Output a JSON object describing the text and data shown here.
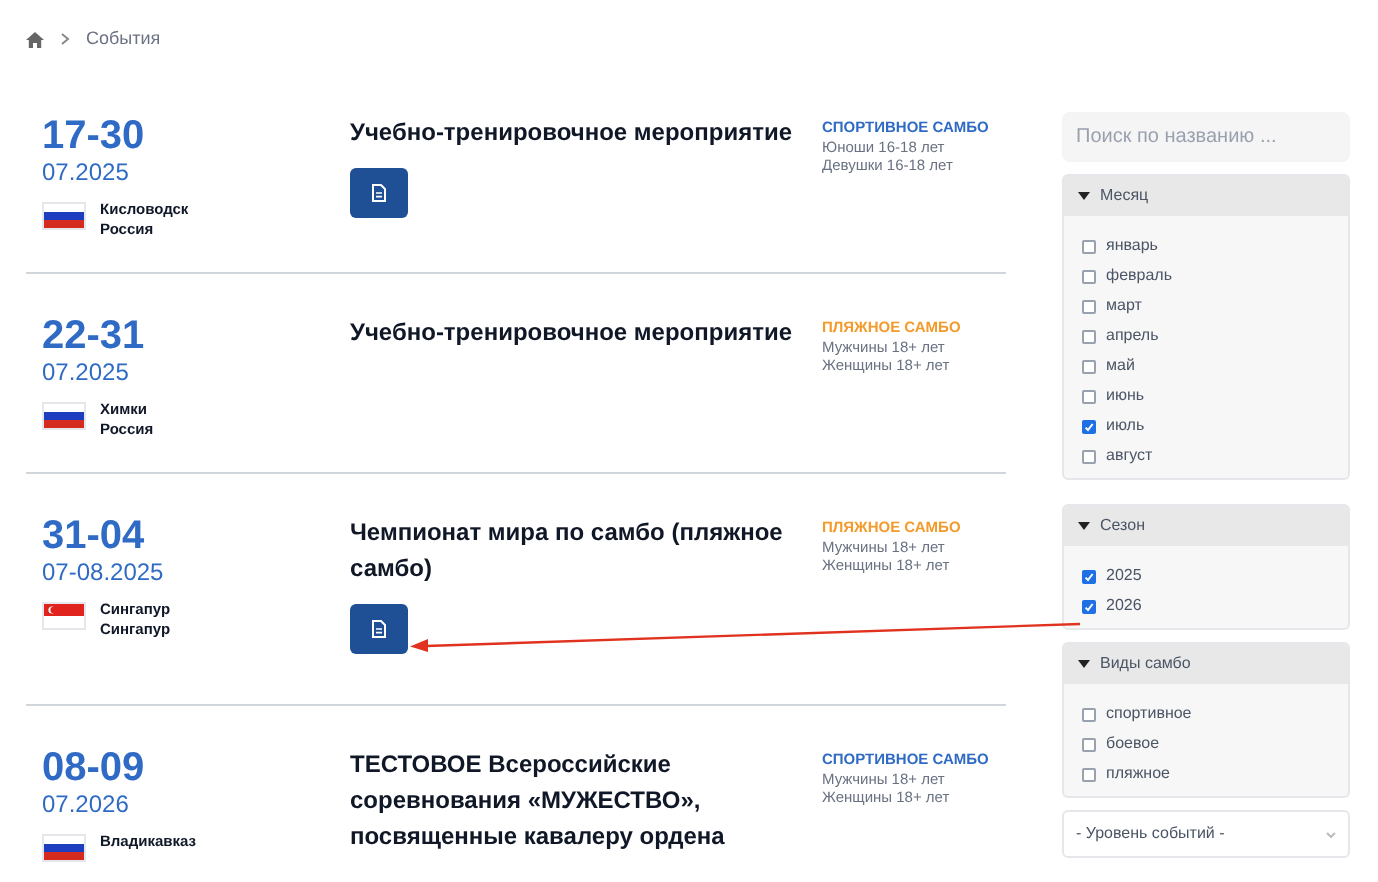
{
  "breadcrumb": {
    "current": "События"
  },
  "events": [
    {
      "days": "17-30",
      "period": "07.2025",
      "flag": {
        "kind": "russia"
      },
      "city": "Кисловодск",
      "country": "Россия",
      "title": "Учебно-тренировочное мероприятие",
      "has_document": true,
      "category": {
        "text": "СПОРТИВНОЕ САМБО",
        "kind": "sport"
      },
      "groups": [
        "Юноши 16-18 лет",
        "Девушки 16-18 лет"
      ]
    },
    {
      "days": "22-31",
      "period": "07.2025",
      "flag": {
        "kind": "russia"
      },
      "city": "Химки",
      "country": "Россия",
      "title": "Учебно-тренировочное мероприятие",
      "has_document": false,
      "category": {
        "text": "ПЛЯЖНОЕ САМБО",
        "kind": "beach"
      },
      "groups": [
        "Мужчины 18+ лет",
        "Женщины 18+ лет"
      ]
    },
    {
      "days": "31-04",
      "period": "07-08.2025",
      "flag": {
        "kind": "singapore"
      },
      "city": "Сингапур",
      "country": "Сингапур",
      "title": "Чемпионат мира по самбо (пляжное самбо)",
      "has_document": true,
      "category": {
        "text": "ПЛЯЖНОЕ САМБО",
        "kind": "beach"
      },
      "groups": [
        "Мужчины 18+ лет",
        "Женщины 18+ лет"
      ]
    },
    {
      "days": "08-09",
      "period": "07.2026",
      "flag": {
        "kind": "russia"
      },
      "city": "Владикавказ",
      "title": "ТЕСТОВОЕ Всероссийские соревнования «МУЖЕСТВО», посвященные кавалеру ордена",
      "has_document": false,
      "category": {
        "text": "СПОРТИВНОЕ САМБО",
        "kind": "sport"
      },
      "groups": [
        "Мужчины 18+ лет",
        "Женщины 18+ лет"
      ]
    }
  ],
  "search": {
    "placeholder": "Поиск по названию ..."
  },
  "filters": [
    {
      "title": "Месяц",
      "options": [
        {
          "label": "январь",
          "checked": false
        },
        {
          "label": "февраль",
          "checked": false
        },
        {
          "label": "март",
          "checked": false
        },
        {
          "label": "апрель",
          "checked": false
        },
        {
          "label": "май",
          "checked": false
        },
        {
          "label": "июнь",
          "checked": false
        },
        {
          "label": "июль",
          "checked": true
        },
        {
          "label": "август",
          "checked": false
        }
      ]
    },
    {
      "title": "Сезон",
      "options": [
        {
          "label": "2025",
          "checked": true
        },
        {
          "label": "2026",
          "checked": true
        }
      ]
    },
    {
      "title": "Виды самбо",
      "options": [
        {
          "label": "спортивное",
          "checked": false
        },
        {
          "label": "боевое",
          "checked": false
        },
        {
          "label": "пляжное",
          "checked": false
        }
      ]
    }
  ],
  "level_select": {
    "value": "- Уровень событий -"
  }
}
